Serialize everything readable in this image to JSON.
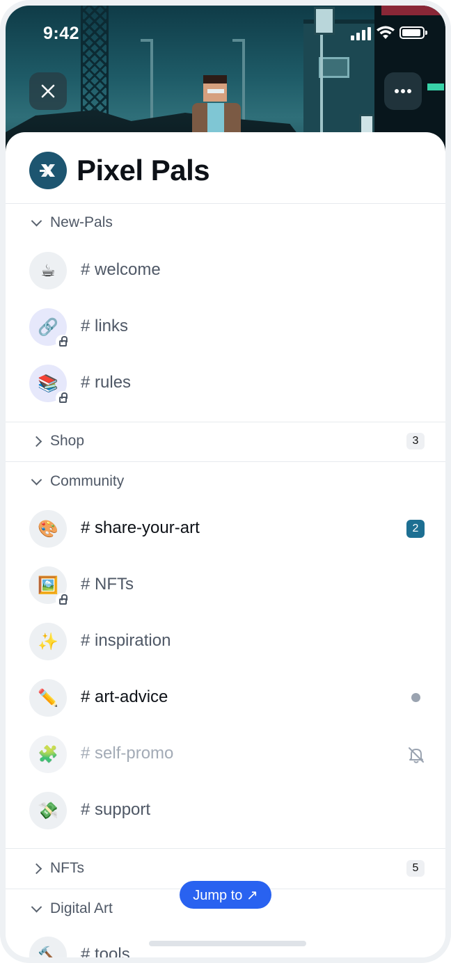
{
  "status_bar": {
    "time": "9:42"
  },
  "header": {
    "close_icon": "close-icon",
    "more_icon": "more-icon",
    "server_name": "Pixel Pals",
    "logo_glyph": "X"
  },
  "categories": [
    {
      "name": "New-Pals",
      "expanded": true,
      "channels": [
        {
          "emoji": "☕",
          "label": "# welcome",
          "locked": false,
          "state": "normal"
        },
        {
          "emoji": "🔗",
          "label": "# links",
          "locked": true,
          "state": "normal"
        },
        {
          "emoji": "📚",
          "label": "# rules",
          "locked": true,
          "state": "normal"
        }
      ]
    },
    {
      "name": "Shop",
      "expanded": false,
      "badge": "3"
    },
    {
      "name": "Community",
      "expanded": true,
      "channels": [
        {
          "emoji": "🎨",
          "label": "# share-your-art",
          "locked": false,
          "state": "unread",
          "count": "2"
        },
        {
          "emoji": "🖼️",
          "label": "# NFTs",
          "locked": true,
          "state": "normal"
        },
        {
          "emoji": "✨",
          "label": "# inspiration",
          "locked": false,
          "state": "normal"
        },
        {
          "emoji": "✏️",
          "label": "# art-advice",
          "locked": false,
          "state": "unread-dot"
        },
        {
          "emoji": "🧩",
          "label": "# self-promo",
          "locked": false,
          "state": "muted"
        },
        {
          "emoji": "💸",
          "label": "# support",
          "locked": false,
          "state": "normal"
        }
      ]
    },
    {
      "name": "NFTs",
      "expanded": false,
      "badge": "5"
    },
    {
      "name": "Digital Art",
      "expanded": true,
      "channels": [
        {
          "emoji": "🔨",
          "label": "# tools",
          "locked": false,
          "state": "normal"
        }
      ]
    }
  ],
  "jump_button": {
    "label": "Jump to ↗"
  },
  "colors": {
    "accent": "#2962f0",
    "unread_badge": "#1d6f92",
    "server_logo": "#1d5570"
  }
}
